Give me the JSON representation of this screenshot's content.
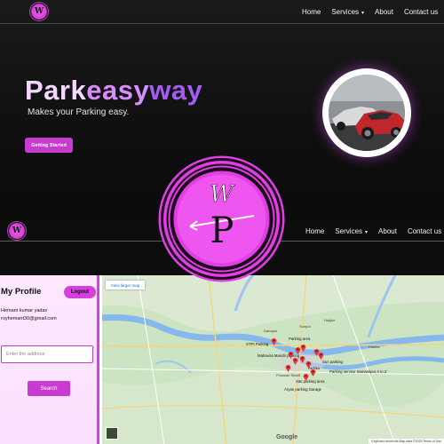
{
  "top_nav": {
    "logo_glyph": "W",
    "items": [
      "Home",
      "Services",
      "About",
      "Contact us"
    ],
    "caret": "▾"
  },
  "hero": {
    "brand_part1": "Park",
    "brand_part2": "easy",
    "brand_part3": "way",
    "tagline": "Makes your Parking easy.",
    "cta_label": "Getting Started"
  },
  "big_logo": {
    "letter_w": "W",
    "letter_p": "P",
    "accent_color": "#e040e8"
  },
  "second_nav": {
    "items": [
      "Home",
      "Services",
      "About",
      "Contact us"
    ],
    "caret": "▾"
  },
  "profile": {
    "title": "My Profile",
    "logout_label": "Logout",
    "name": "Hemant kumar yadav",
    "email": "royhemant30@gmail.com",
    "address_placeholder": "Enter the address",
    "search_label": "Search"
  },
  "map": {
    "larger_map_label": "View larger map",
    "google_label": "Google",
    "footer_text": "Keyboard shortcuts   Map data ©2023   Terms of Use",
    "labels": [
      "Parking area",
      "Sati parking area",
      "STPI Parking",
      "Mahavira Mandir parking",
      "Sun parking",
      "Parking service Samastipur A to Z",
      "Aryan parking Garage",
      "PATNA",
      "Danapur",
      "Hajipur",
      "Phulwari Sharif",
      "Sonpur",
      "Fatuha"
    ]
  },
  "colors": {
    "accent": "#c93ad0",
    "nav_bg": "#0d0d0d",
    "profile_bg": "#fde8ff"
  }
}
